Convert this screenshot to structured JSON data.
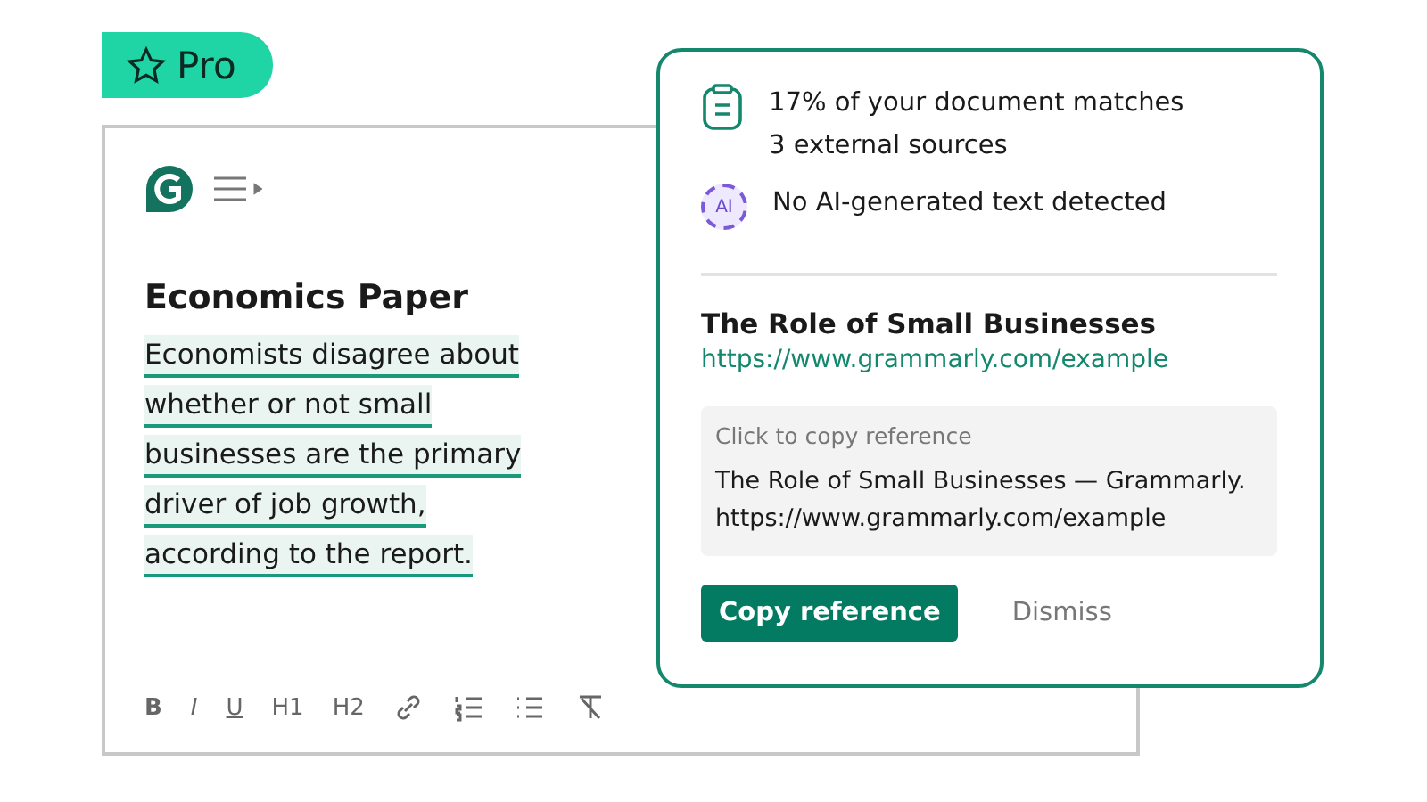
{
  "badge": {
    "label": "Pro"
  },
  "editor": {
    "title": "Economics Paper",
    "lines": [
      "Economists disagree about",
      "whether or not small",
      "businesses are the primary",
      "driver of job growth,",
      "according to the report."
    ],
    "toolbar": [
      {
        "kind": "bold",
        "label": "B"
      },
      {
        "kind": "italic",
        "label": "I"
      },
      {
        "kind": "underline",
        "label": "U"
      },
      {
        "kind": "heading",
        "label": "H1"
      },
      {
        "kind": "heading",
        "label": "H2"
      },
      {
        "kind": "link"
      },
      {
        "kind": "numbered-list"
      },
      {
        "kind": "bullet-list"
      },
      {
        "kind": "clear-format"
      }
    ]
  },
  "card": {
    "findings": [
      {
        "kind": "plagiarism",
        "lines": [
          "17% of your document matches",
          "3 external sources"
        ]
      },
      {
        "kind": "ai",
        "icon_text": "AI",
        "lines": [
          "No AI-generated text detected"
        ]
      }
    ],
    "source_title": "The Role of Small Businesses",
    "source_url": "https://www.grammarly.com/example",
    "reference": {
      "hint": "Click to copy reference",
      "text": "The Role of Small Businesses — Grammarly.",
      "url": "https://www.grammarly.com/example"
    },
    "buttons": [
      {
        "kind": "primary",
        "label": "Copy reference"
      },
      {
        "kind": "secondary",
        "label": "Dismiss"
      }
    ]
  }
}
